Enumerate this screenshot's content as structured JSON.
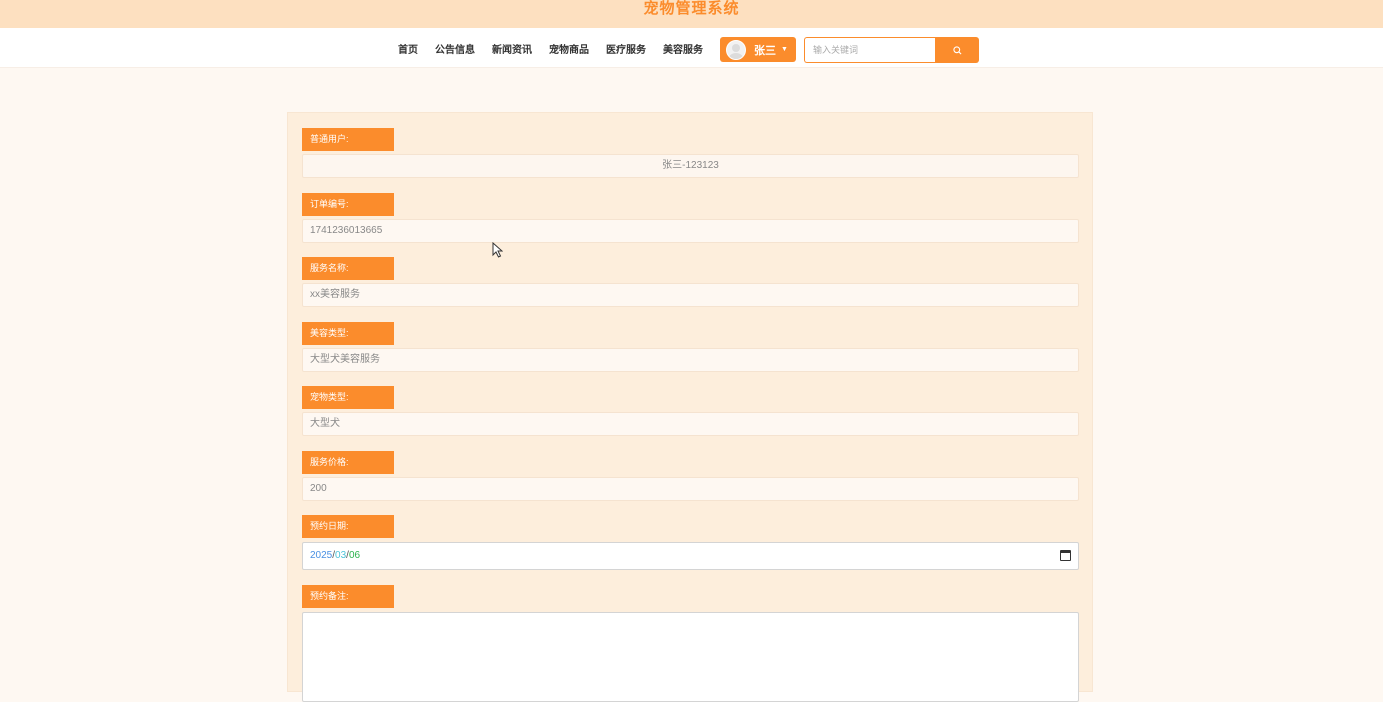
{
  "header": {
    "title": "宠物管理系统"
  },
  "nav": {
    "links": [
      "首页",
      "公告信息",
      "新闻资讯",
      "宠物商品",
      "医疗服务",
      "美容服务"
    ],
    "user_name": "张三",
    "search_placeholder": "输入关键词"
  },
  "form": {
    "fields": [
      {
        "label": "普通用户:",
        "value": "张三-123123"
      },
      {
        "label": "订单编号:",
        "value": "1741236013665"
      },
      {
        "label": "服务名称:",
        "value": "xx美容服务"
      },
      {
        "label": "美容类型:",
        "value": "大型犬美容服务"
      },
      {
        "label": "宠物类型:",
        "value": "大型犬"
      },
      {
        "label": "服务价格:",
        "value": "200"
      }
    ],
    "date_label": "预约日期:",
    "date_year": "2025",
    "date_month": "03",
    "date_day": "06",
    "date_sep": "/",
    "remark_label": "预约备注:"
  },
  "icons": {
    "search": "search-icon",
    "calendar": "calendar-icon",
    "avatar": "user-avatar-icon",
    "cursor": "mouse-cursor-icon"
  },
  "colors": {
    "accent": "#fb8c2c",
    "header_bg": "#fde0c0",
    "panel_bg": "#fdeedc"
  }
}
